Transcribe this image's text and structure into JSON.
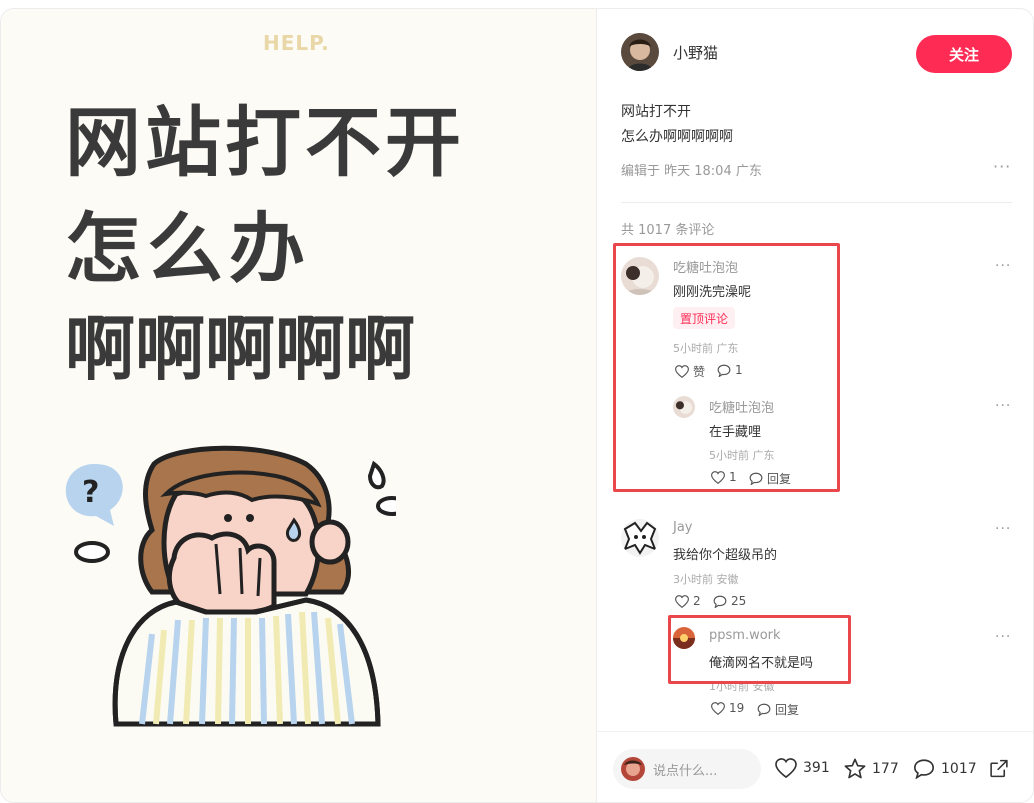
{
  "image": {
    "help_text": "HELP.",
    "headline": [
      "网站打不开",
      "怎么办",
      "啊啊啊啊啊"
    ]
  },
  "author": {
    "name": "小野猫",
    "follow_label": "关注"
  },
  "post": {
    "title": "网站打不开",
    "body": "怎么办啊啊啊啊啊",
    "meta": "编辑于 昨天 18:04 广东",
    "more": "···"
  },
  "comments_count": "共 1017 条评论",
  "comments": [
    {
      "name": "吃糖吐泡泡",
      "text": "刚刚洗完澡呢",
      "pin_label": "置顶评论",
      "meta": "5小时前 广东",
      "like_label": "赞",
      "reply_count": "1",
      "more": "···",
      "reply": {
        "name": "吃糖吐泡泡",
        "text": "在手藏哩",
        "meta": "5小时前 广东",
        "like_count": "1",
        "reply_label": "回复",
        "more": "···"
      }
    },
    {
      "name": "Jay",
      "text": "我给你个超级吊的",
      "meta": "3小时前 安徽",
      "like_count": "2",
      "reply_count": "25",
      "more": "···",
      "reply": {
        "name": "ppsm.work",
        "text": "俺滴网名不就是吗",
        "meta": "1小时前 安徽",
        "like_count": "19",
        "reply_label": "回复",
        "more": "···"
      }
    }
  ],
  "bottom_bar": {
    "input_placeholder": "说点什么...",
    "likes": "391",
    "stars": "177",
    "comments": "1017"
  },
  "colors": {
    "accent": "#fe2c55",
    "highlight_box": "#e9474c",
    "canvas_bg": "#fcfbf6"
  }
}
